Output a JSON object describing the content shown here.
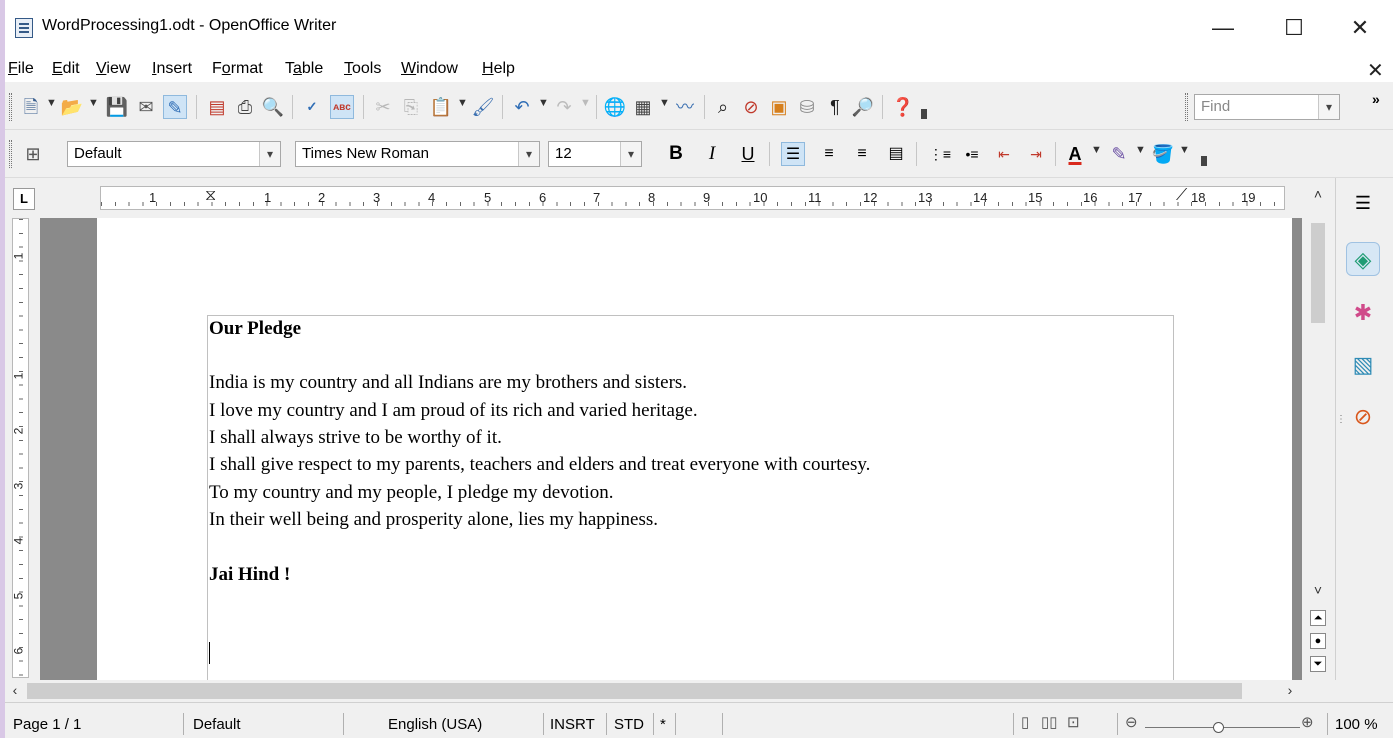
{
  "window": {
    "title": "WordProcessing1.odt - OpenOffice Writer",
    "minimize": "—",
    "maximize": "☐",
    "close": "✕"
  },
  "menu": {
    "items": [
      {
        "pre": "",
        "u": "F",
        "post": "ile"
      },
      {
        "pre": "",
        "u": "E",
        "post": "dit"
      },
      {
        "pre": "",
        "u": "V",
        "post": "iew"
      },
      {
        "pre": "",
        "u": "I",
        "post": "nsert"
      },
      {
        "pre": "F",
        "u": "o",
        "post": "rmat"
      },
      {
        "pre": "T",
        "u": "a",
        "post": "ble"
      },
      {
        "pre": "",
        "u": "T",
        "post": "ools"
      },
      {
        "pre": "",
        "u": "W",
        "post": "indow"
      },
      {
        "pre": "",
        "u": "H",
        "post": "elp"
      }
    ],
    "close_doc": "✕"
  },
  "standard_toolbar": {
    "find_placeholder": "Find"
  },
  "formatting_toolbar": {
    "style": "Default",
    "font": "Times New Roman",
    "size": "12",
    "bold": "B",
    "italic": "I",
    "underline": "U",
    "font_color_letter": "A"
  },
  "ruler": {
    "labels": [
      "1",
      "1",
      "2",
      "3",
      "4",
      "5",
      "6",
      "7",
      "8",
      "9",
      "10",
      "11",
      "12",
      "13",
      "14",
      "15",
      "16",
      "17",
      "18",
      "19"
    ],
    "vertical_labels": [
      "1",
      "1",
      "2",
      "3",
      "4",
      "5",
      "6"
    ]
  },
  "document": {
    "heading": "Our Pledge",
    "lines": [
      "India is my country and all Indians are my brothers and sisters.",
      "I love my country and I am proud of its rich and varied heritage.",
      "I shall always strive to be worthy of it.",
      "I shall give respect to my parents, teachers and elders and treat everyone with courtesy.",
      "To my country and my people, I pledge my devotion.",
      "In their well being and prosperity alone, lies my happiness."
    ],
    "closing": "Jai Hind !"
  },
  "status": {
    "page": "Page 1 / 1",
    "style": "Default",
    "language": "English (USA)",
    "insert_mode": "INSRT",
    "selection_mode": "STD",
    "modified": "*",
    "zoom": "100 %"
  },
  "colors": {
    "accent": "#2f6db5",
    "page_background": "#8a8a8a"
  }
}
